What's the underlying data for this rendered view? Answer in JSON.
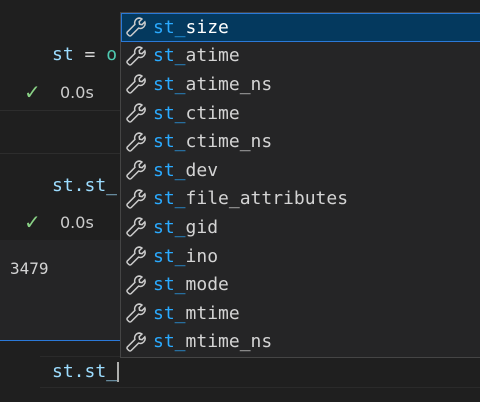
{
  "cells": [
    {
      "code_var": "st",
      "code_op": " = ",
      "code_rest": "o",
      "status_time": "0.0s"
    },
    {
      "code_var": "st.st_",
      "status_time": "0.0s",
      "output": "3479"
    }
  ],
  "active_input": {
    "text": "st.st_"
  },
  "suggestions": {
    "match_prefix": "st_",
    "items": [
      {
        "prefix": "st_",
        "rest": "size",
        "selected": true
      },
      {
        "prefix": "st_",
        "rest": "atime"
      },
      {
        "prefix": "st_",
        "rest": "atime_ns"
      },
      {
        "prefix": "st_",
        "rest": "ctime"
      },
      {
        "prefix": "st_",
        "rest": "ctime_ns"
      },
      {
        "prefix": "st_",
        "rest": "dev"
      },
      {
        "prefix": "st_",
        "rest": "file_attributes"
      },
      {
        "prefix": "st_",
        "rest": "gid"
      },
      {
        "prefix": "st_",
        "rest": "ino"
      },
      {
        "prefix": "st_",
        "rest": "mode"
      },
      {
        "prefix": "st_",
        "rest": "mtime"
      },
      {
        "prefix": "st_",
        "rest": "mtime_ns"
      }
    ],
    "icon": "wrench-icon"
  },
  "colors": {
    "background": "#1f1f1f",
    "widget_bg": "#252526",
    "selected_bg": "#04395e",
    "highlight": "#2aaaff",
    "check": "#89d185",
    "focus": "#2b79d8"
  }
}
